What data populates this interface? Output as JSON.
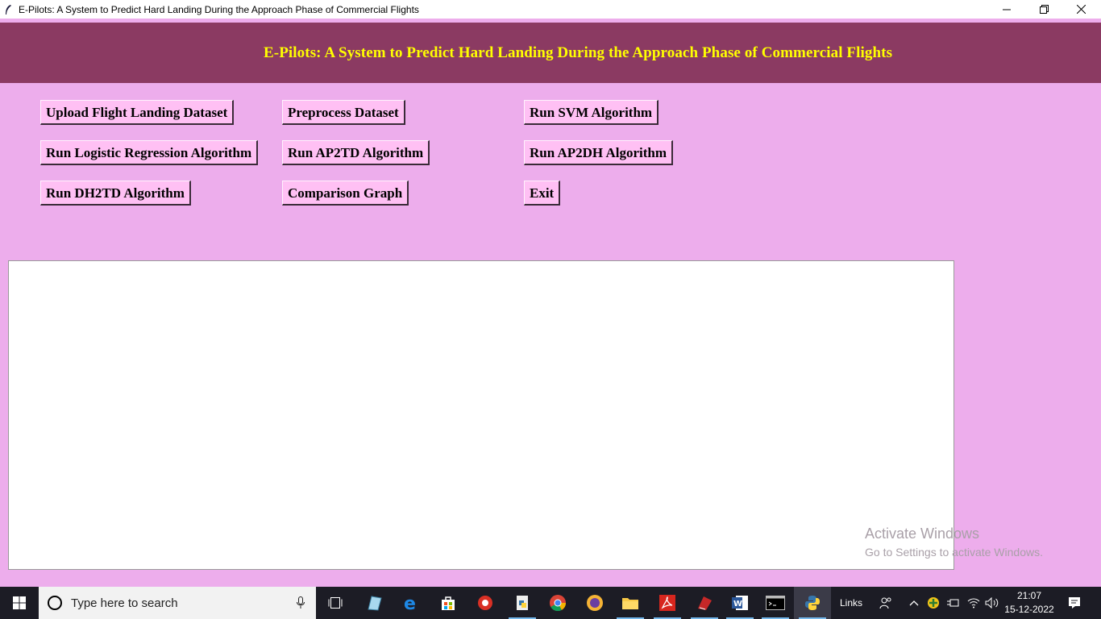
{
  "window": {
    "title": "E-Pilots: A System to Predict Hard Landing During the Approach Phase of Commercial Flights"
  },
  "header": {
    "title": "E-Pilots: A System to Predict Hard Landing During the Approach Phase of Commercial Flights"
  },
  "buttons": {
    "upload": "Upload Flight Landing Dataset",
    "preprocess": "Preprocess Dataset",
    "svm": "Run SVM Algorithm",
    "logistic": "Run Logistic Regression Algorithm",
    "ap2td": "Run AP2TD Algorithm",
    "ap2dh": "Run AP2DH Algorithm",
    "dh2td": "Run DH2TD Algorithm",
    "comparison": "Comparison Graph",
    "exit": "Exit"
  },
  "watermark": {
    "line1": "Activate Windows",
    "line2": "Go to Settings to activate Windows."
  },
  "taskbar": {
    "search_placeholder": "Type here to search",
    "links_label": "Links",
    "time": "21:07",
    "date": "15-12-2022"
  },
  "colors": {
    "app_bg": "#edadec",
    "header_bg": "#8b3a62",
    "header_text": "#ffff00",
    "button_bg": "#ffc0f4",
    "taskbar_bg": "#1c1c25"
  },
  "icons": [
    "feather-icon",
    "minimize-icon",
    "maximize-icon",
    "close-icon",
    "windows-start-icon",
    "cortana-icon",
    "microphone-icon",
    "task-view-icon",
    "edge-icon",
    "store-icon",
    "chrome-icon",
    "acrobat-icon",
    "word-icon",
    "file-explorer-icon",
    "terminal-icon",
    "python-icon",
    "people-icon",
    "chevron-up-icon",
    "wifi-icon",
    "volume-icon",
    "notification-icon"
  ]
}
